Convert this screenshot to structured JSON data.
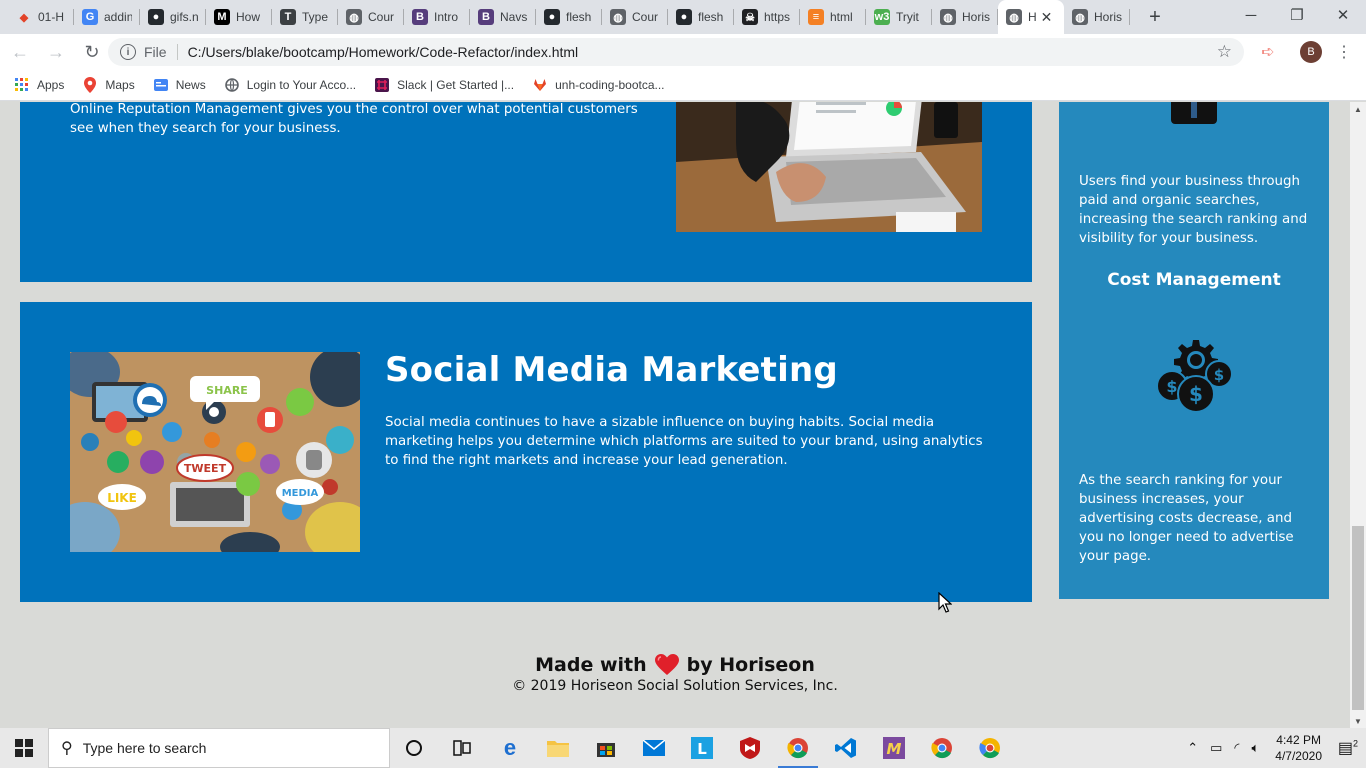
{
  "browser": {
    "tabs": [
      {
        "title": "01-H",
        "icon": "gitlab-icon",
        "color": "#e24329"
      },
      {
        "title": "addin",
        "icon": "google-icon",
        "color": "#4285f4"
      },
      {
        "title": "gifs.n",
        "icon": "github-icon",
        "color": "#24292e"
      },
      {
        "title": "How",
        "icon": "medium-icon",
        "color": "#000000"
      },
      {
        "title": "Type",
        "icon": "typescript-icon",
        "color": "#3c4043"
      },
      {
        "title": "Cour",
        "icon": "globe-icon",
        "color": "#5f6368"
      },
      {
        "title": "Intro",
        "icon": "bootstrap-icon",
        "color": "#563d7c"
      },
      {
        "title": "Navs",
        "icon": "bootstrap-icon",
        "color": "#563d7c"
      },
      {
        "title": "flesh",
        "icon": "github-icon",
        "color": "#24292e"
      },
      {
        "title": "Cour",
        "icon": "globe-icon",
        "color": "#5f6368"
      },
      {
        "title": "flesh",
        "icon": "github-icon",
        "color": "#24292e"
      },
      {
        "title": "https",
        "icon": "skull-icon",
        "color": "#202124"
      },
      {
        "title": "html",
        "icon": "stackoverflow-icon",
        "color": "#f48024"
      },
      {
        "title": "Tryit",
        "icon": "w3schools-icon",
        "color": "#4caf50"
      },
      {
        "title": "Horis",
        "icon": "globe-icon",
        "color": "#5f6368"
      },
      {
        "title": "H",
        "icon": "globe-icon",
        "color": "#5f6368",
        "active": true
      },
      {
        "title": "Horis",
        "icon": "globe-icon",
        "color": "#5f6368"
      }
    ],
    "window_controls": {
      "minimize": "─",
      "restore": "❐",
      "close": "✕"
    },
    "address": {
      "scheme": "File",
      "url": "C:/Users/blake/bootcamp/Homework/Code-Refactor/index.html"
    },
    "profile_initial": "B",
    "bookmarks": [
      {
        "label": "Apps",
        "icon": "apps-grid-icon"
      },
      {
        "label": "Maps",
        "icon": "maps-pin-icon"
      },
      {
        "label": "News",
        "icon": "news-icon"
      },
      {
        "label": "Login to Your Acco...",
        "icon": "globe-icon"
      },
      {
        "label": "Slack | Get Started |...",
        "icon": "slack-icon"
      },
      {
        "label": "unh-coding-bootca...",
        "icon": "gitlab-icon"
      }
    ]
  },
  "page": {
    "reputation_text": "The web is full of opinions, and some of these can be negative. Social media allows anyone with an internet connection to say whatever they want about your business. Online Reputation Management gives you the control over what potential customers see when they search for your business.",
    "social": {
      "title": "Social Media Marketing",
      "text": "Social media continues to have a sizable influence on buying habits. Social media marketing helps you determine which platforms are suited to your brand, using analytics to find the right markets and increase your lead generation.",
      "image_words": [
        "SHARE",
        "TWEET",
        "LIKE",
        "MEDIA"
      ]
    },
    "aside": {
      "lead_text": "Users find your business through paid and organic searches, increasing the search ranking and visibility for your business.",
      "cost_title": "Cost Management",
      "cost_text": "As the search ranking for your business increases, your advertising costs decrease, and you no longer need to advertise your page."
    },
    "footer": {
      "made_prefix": "Made with",
      "made_suffix": "by Horiseon",
      "copyright": "© 2019 Horiseon Social Solution Services, Inc."
    },
    "colors": {
      "card_blue": "#0072bb",
      "aside_blue": "#2589bd",
      "background": "#d9dad7"
    }
  },
  "taskbar": {
    "search_placeholder": "Type here to search",
    "time": "4:42 PM",
    "date": "4/7/2020",
    "notification_count": "2",
    "apps": [
      "cortana-icon",
      "task-view-icon",
      "edge-icon",
      "file-explorer-icon",
      "store-icon",
      "mail-icon",
      "l-app-icon",
      "mcafee-icon",
      "chrome-icon",
      "vscode-icon",
      "m-app-icon",
      "chrome-icon",
      "chrome-canary-icon"
    ]
  }
}
